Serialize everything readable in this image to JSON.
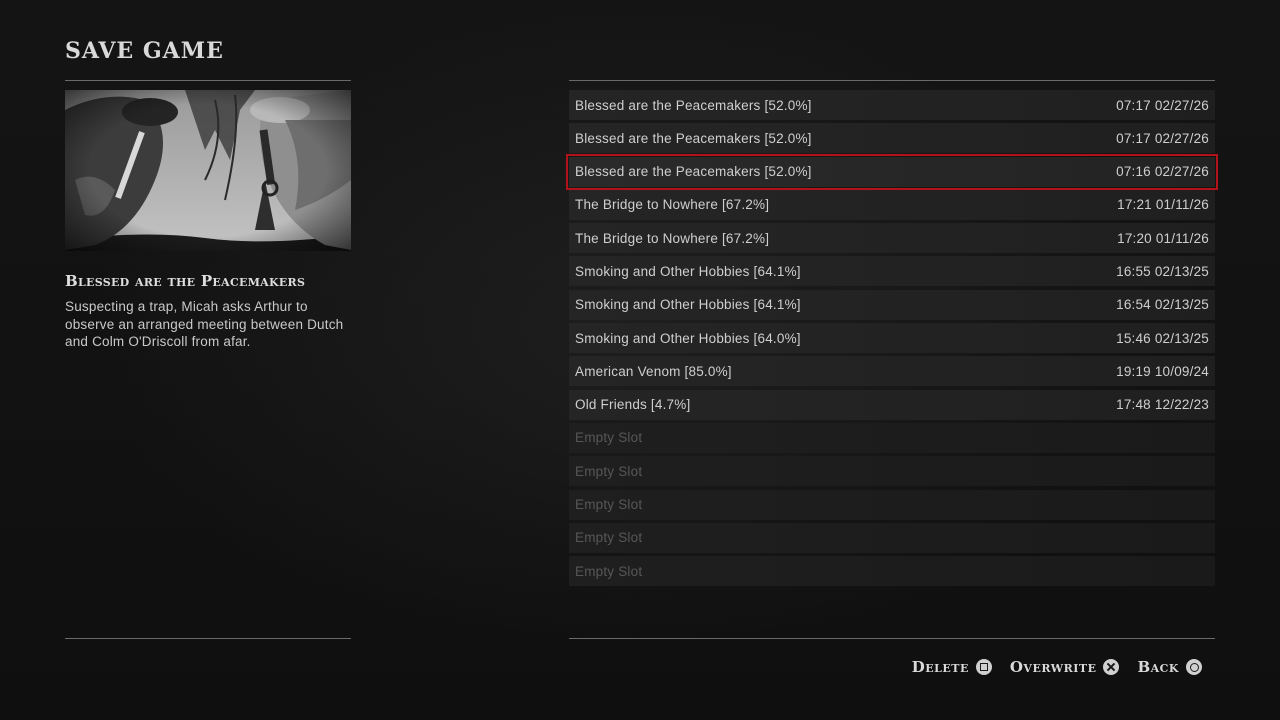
{
  "header": {
    "title": "SAVE GAME"
  },
  "selected_mission": {
    "title": "Blessed are the Peacemakers",
    "description": "Suspecting a trap, Micah asks Arthur to observe an arranged meeting between Dutch and Colm O'Driscoll from afar."
  },
  "save_slots": [
    {
      "name": "Blessed are the Peacemakers [52.0%]",
      "timestamp": "07:17 02/27/26"
    },
    {
      "name": "Blessed are the Peacemakers [52.0%]",
      "timestamp": "07:17 02/27/26"
    },
    {
      "name": "Blessed are the Peacemakers [52.0%]",
      "timestamp": "07:16 02/27/26"
    },
    {
      "name": "The Bridge to Nowhere [67.2%]",
      "timestamp": "17:21 01/11/26"
    },
    {
      "name": "The Bridge to Nowhere [67.2%]",
      "timestamp": "17:20 01/11/26"
    },
    {
      "name": "Smoking and Other Hobbies [64.1%]",
      "timestamp": "16:55 02/13/25"
    },
    {
      "name": "Smoking and Other Hobbies [64.1%]",
      "timestamp": "16:54 02/13/25"
    },
    {
      "name": "Smoking and Other Hobbies [64.0%]",
      "timestamp": "15:46 02/13/25"
    },
    {
      "name": "American Venom [85.0%]",
      "timestamp": "19:19 10/09/24"
    },
    {
      "name": "Old Friends [4.7%]",
      "timestamp": "17:48 12/22/23"
    },
    {
      "name": "Empty Slot",
      "timestamp": ""
    },
    {
      "name": "Empty Slot",
      "timestamp": ""
    },
    {
      "name": "Empty Slot",
      "timestamp": ""
    },
    {
      "name": "Empty Slot",
      "timestamp": ""
    },
    {
      "name": "Empty Slot",
      "timestamp": ""
    }
  ],
  "selected_slot_index": 2,
  "footer": {
    "delete_label": "Delete",
    "delete_icon": "square-button-icon",
    "overwrite_label": "Overwrite",
    "overwrite_icon": "cross-button-icon",
    "back_label": "Back",
    "back_icon": "circle-button-icon"
  },
  "colors": {
    "selection_outline": "#b3121a",
    "background": "#121212",
    "slot_background": "#252525",
    "empty_slot_text": "#575757"
  }
}
